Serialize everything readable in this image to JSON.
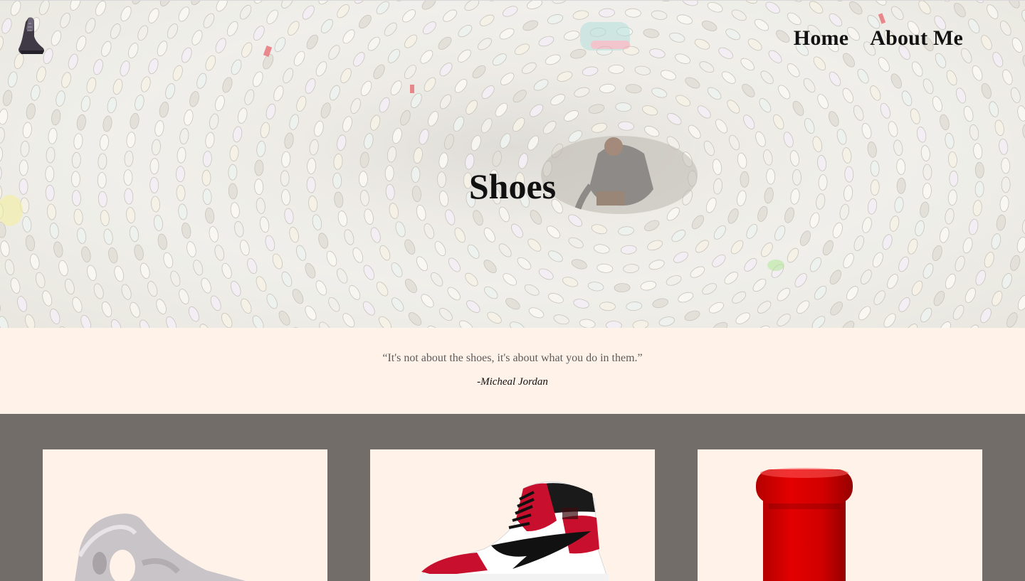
{
  "nav": {
    "home_label": "Home",
    "about_label": "About Me"
  },
  "hero": {
    "title": "Shoes"
  },
  "quote": {
    "text": "“It's not about the shoes, it's about what you do in them.”",
    "author": "-Micheal Jordan"
  },
  "colors": {
    "quote_band": "#fff2e9",
    "gallery_background": "#736d69",
    "card_background": "#fff2e9",
    "text_dark": "#111111"
  },
  "gallery": {
    "cards": [
      {
        "image": "foam-runner-shoe"
      },
      {
        "image": "red-white-high-top-sneaker"
      },
      {
        "image": "red-boot"
      }
    ]
  }
}
